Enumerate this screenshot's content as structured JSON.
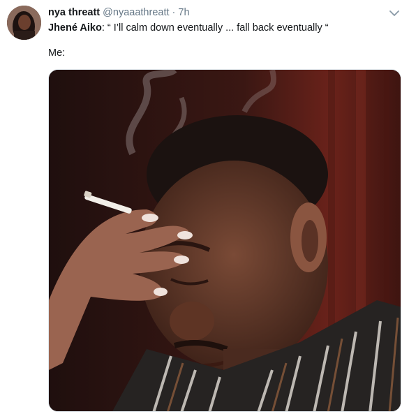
{
  "tweet": {
    "author_name": "nya threatt",
    "handle": "@nyaaathreatt",
    "separator": "·",
    "time": "7h",
    "quote_speaker": "Jhené Aiko",
    "quote_text": ": “ I’ll calm down eventually ... fall back eventually “",
    "me_label": "Me:",
    "caret_icon": "chevron-down-icon",
    "media_description_icon": "photo"
  }
}
